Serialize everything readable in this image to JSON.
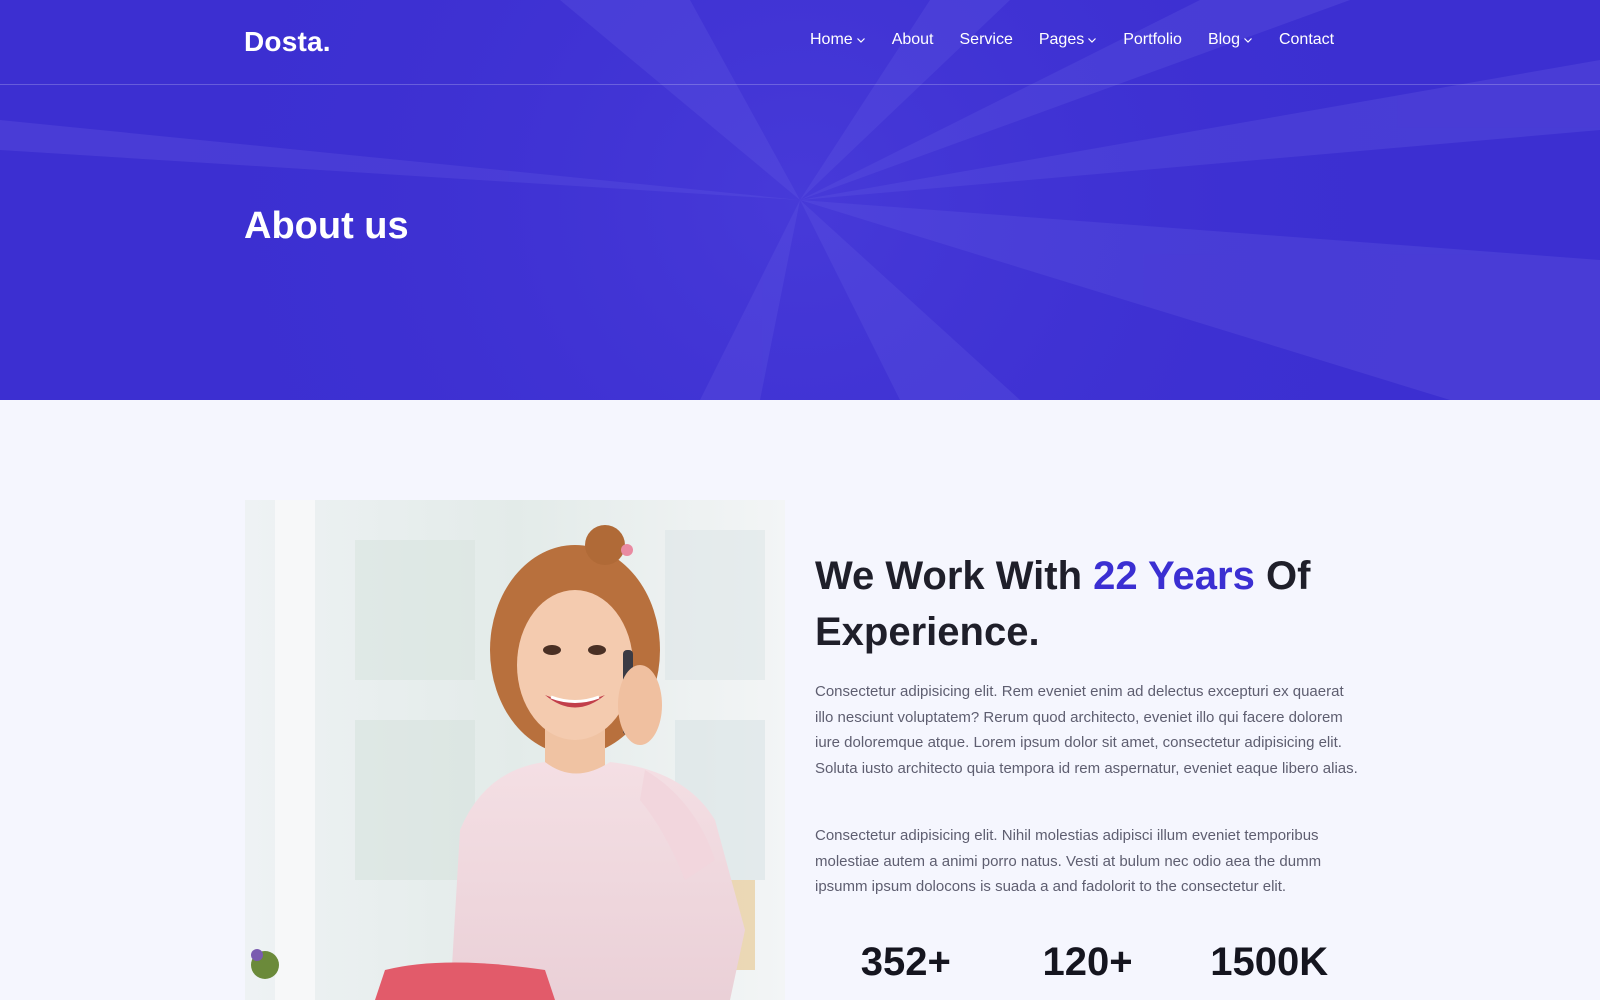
{
  "brand": {
    "logo_text": "Dosta."
  },
  "nav": {
    "items": [
      {
        "label": "Home",
        "icon": "chevron-down-icon"
      },
      {
        "label": "About"
      },
      {
        "label": "Service"
      },
      {
        "label": "Pages",
        "icon": "chevron-down-icon"
      },
      {
        "label": "Portfolio"
      },
      {
        "label": "Blog",
        "icon": "chevron-down-icon"
      },
      {
        "label": "Contact"
      }
    ]
  },
  "hero": {
    "title": "About us"
  },
  "about": {
    "heading_pre": "We Work With ",
    "heading_accent": "22 Years",
    "heading_post": " Of Experience.",
    "paragraph_1": "Consectetur adipisicing elit. Rem eveniet enim ad delectus excepturi ex quaerat illo nesciunt voluptatem? Rerum quod architecto, eveniet illo qui facere dolorem iure doloremque atque. Lorem ipsum dolor sit amet, consectetur adipisicing elit. Soluta iusto architecto quia tempora id rem aspernatur, eveniet eaque libero alias.",
    "paragraph_2": "Consectetur adipisicing elit. Nihil molestias adipisci illum eveniet temporibus molestiae autem a animi porro natus. Vesti at bulum nec odio aea the dumm ipsumm ipsum dolocons is suada a and fadolorit to the consectetur elit.",
    "stats": [
      {
        "value": "352+"
      },
      {
        "value": "120+"
      },
      {
        "value": "1500K"
      }
    ]
  },
  "colors": {
    "primary": "#3b2fd2",
    "hero_bg": "#3b2fd2",
    "section_bg": "#f5f6fe",
    "heading": "#1f1f2a",
    "body_text": "#5e5e70"
  }
}
